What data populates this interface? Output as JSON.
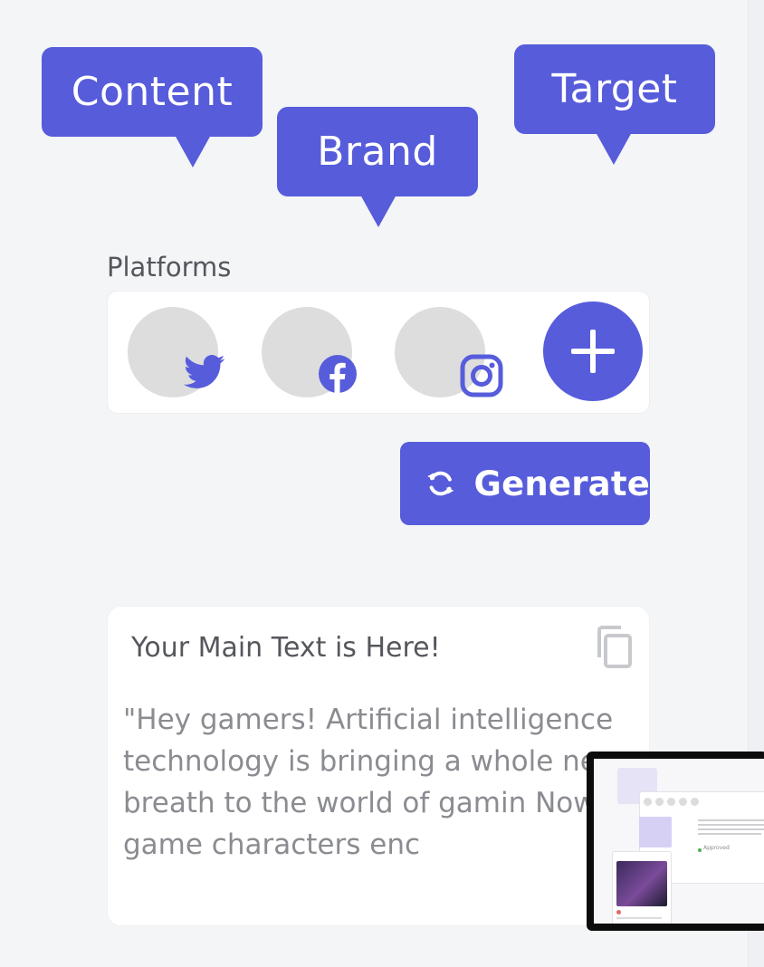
{
  "bubbles": {
    "content": "Content",
    "brand": "Brand",
    "target": "Target"
  },
  "platforms": {
    "label": "Platforms",
    "items": [
      {
        "name": "Twitter",
        "icon": "twitter-icon"
      },
      {
        "name": "Facebook",
        "icon": "facebook-icon"
      },
      {
        "name": "Instagram",
        "icon": "instagram-icon"
      }
    ],
    "add_icon": "plus-icon"
  },
  "generate": {
    "label": "Generate",
    "icon": "refresh-icon"
  },
  "main_text": {
    "title": "Your Main Text is Here!",
    "body": "\"Hey gamers! Artificial intelligence technology is bringing a whole new breath to the world of gamin Now, game characters enc",
    "copy_icon": "copy-icon"
  },
  "thumbnail": {
    "status": "Approved"
  },
  "colors": {
    "accent": "#575cdb",
    "background": "#f4f5f7",
    "placeholder_circle": "#dddddd"
  }
}
